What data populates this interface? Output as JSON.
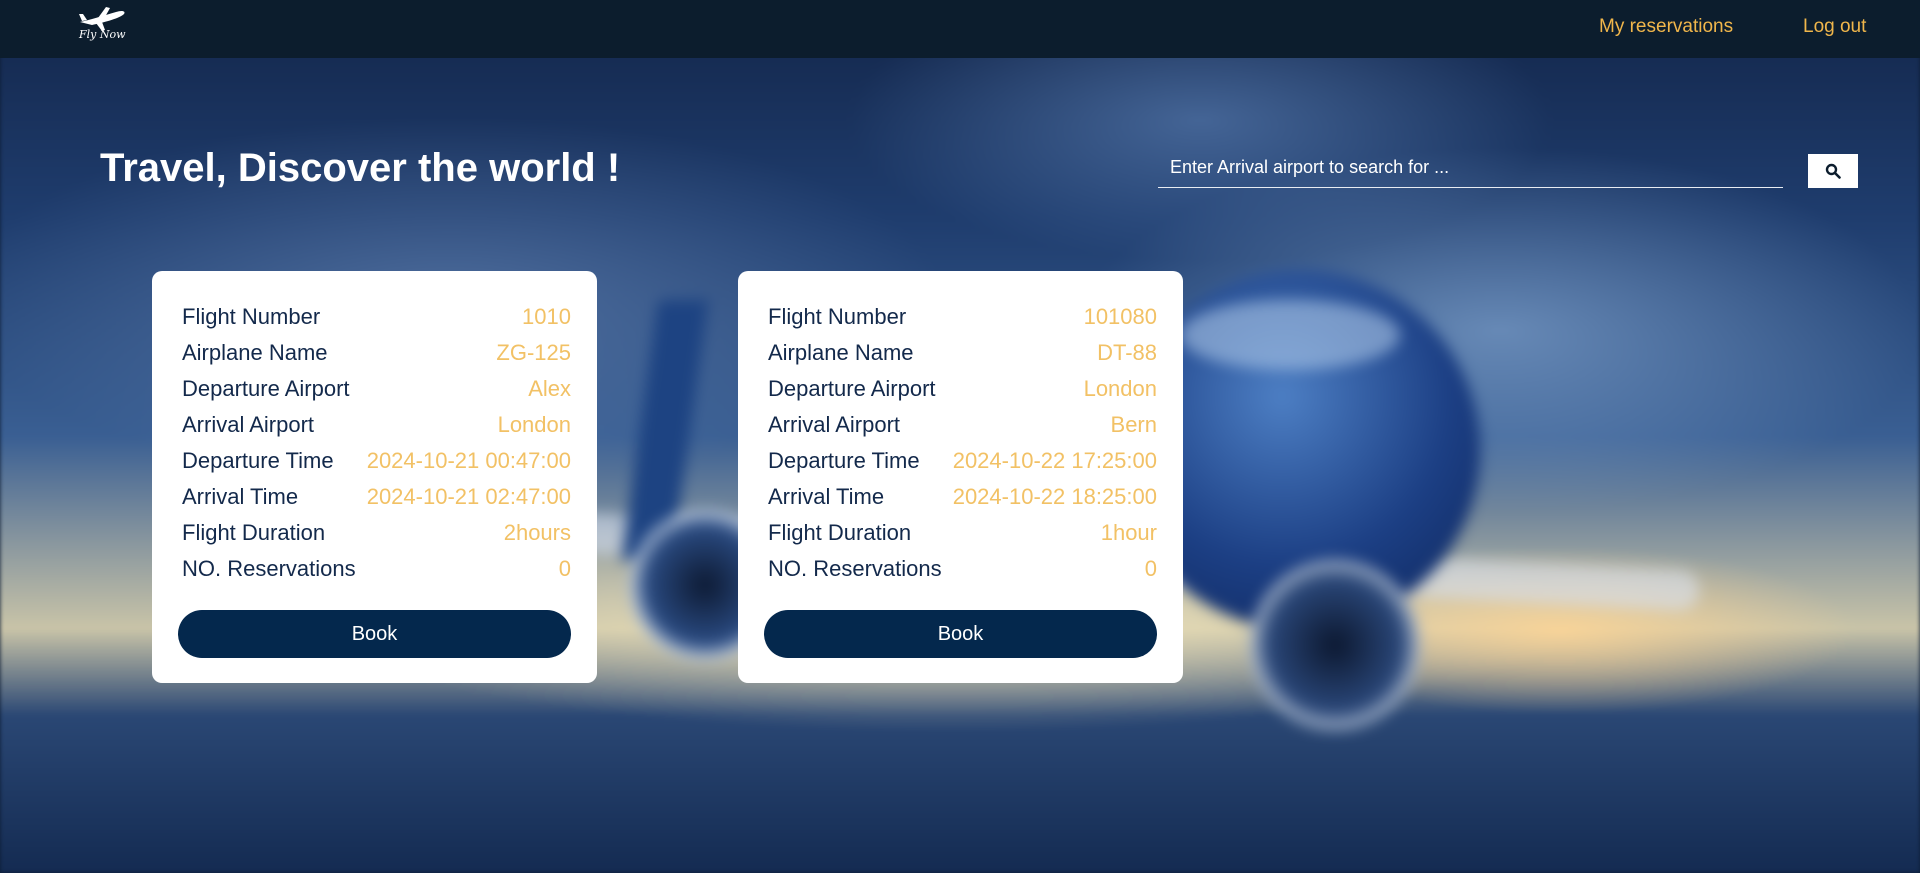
{
  "nav": {
    "logo_text": "Fly Now",
    "links": [
      "My reservations",
      "Log out"
    ]
  },
  "hero": {
    "title": "Travel, Discover the world !"
  },
  "search": {
    "placeholder": "Enter Arrival airport to search for ...",
    "value": ""
  },
  "labels": {
    "flight_number": "Flight Number",
    "airplane_name": "Airplane Name",
    "departure_airport": "Departure Airport",
    "arrival_airport": "Arrival Airport",
    "departure_time": "Departure Time",
    "arrival_time": "Arrival Time",
    "flight_duration": "Flight Duration",
    "reservations": "NO. Reservations",
    "book": "Book"
  },
  "flights": [
    {
      "flight_number": "1010",
      "airplane_name": "ZG-125",
      "departure_airport": "Alex",
      "arrival_airport": "London",
      "departure_time": "2024-10-21 00:47:00",
      "arrival_time": "2024-10-21 02:47:00",
      "flight_duration": "2hours",
      "reservations": "0"
    },
    {
      "flight_number": "101080",
      "airplane_name": "DT-88",
      "departure_airport": "London",
      "arrival_airport": "Bern",
      "departure_time": "2024-10-22 17:25:00",
      "arrival_time": "2024-10-22 18:25:00",
      "flight_duration": "1hour",
      "reservations": "0"
    }
  ],
  "colors": {
    "navbar": "#0c1d2d",
    "accent": "#f0b64b",
    "value": "#f2c165",
    "label": "#13294b",
    "button": "#04284d"
  },
  "icons": {
    "logo": "airplane-logo-icon",
    "search": "search-icon"
  }
}
